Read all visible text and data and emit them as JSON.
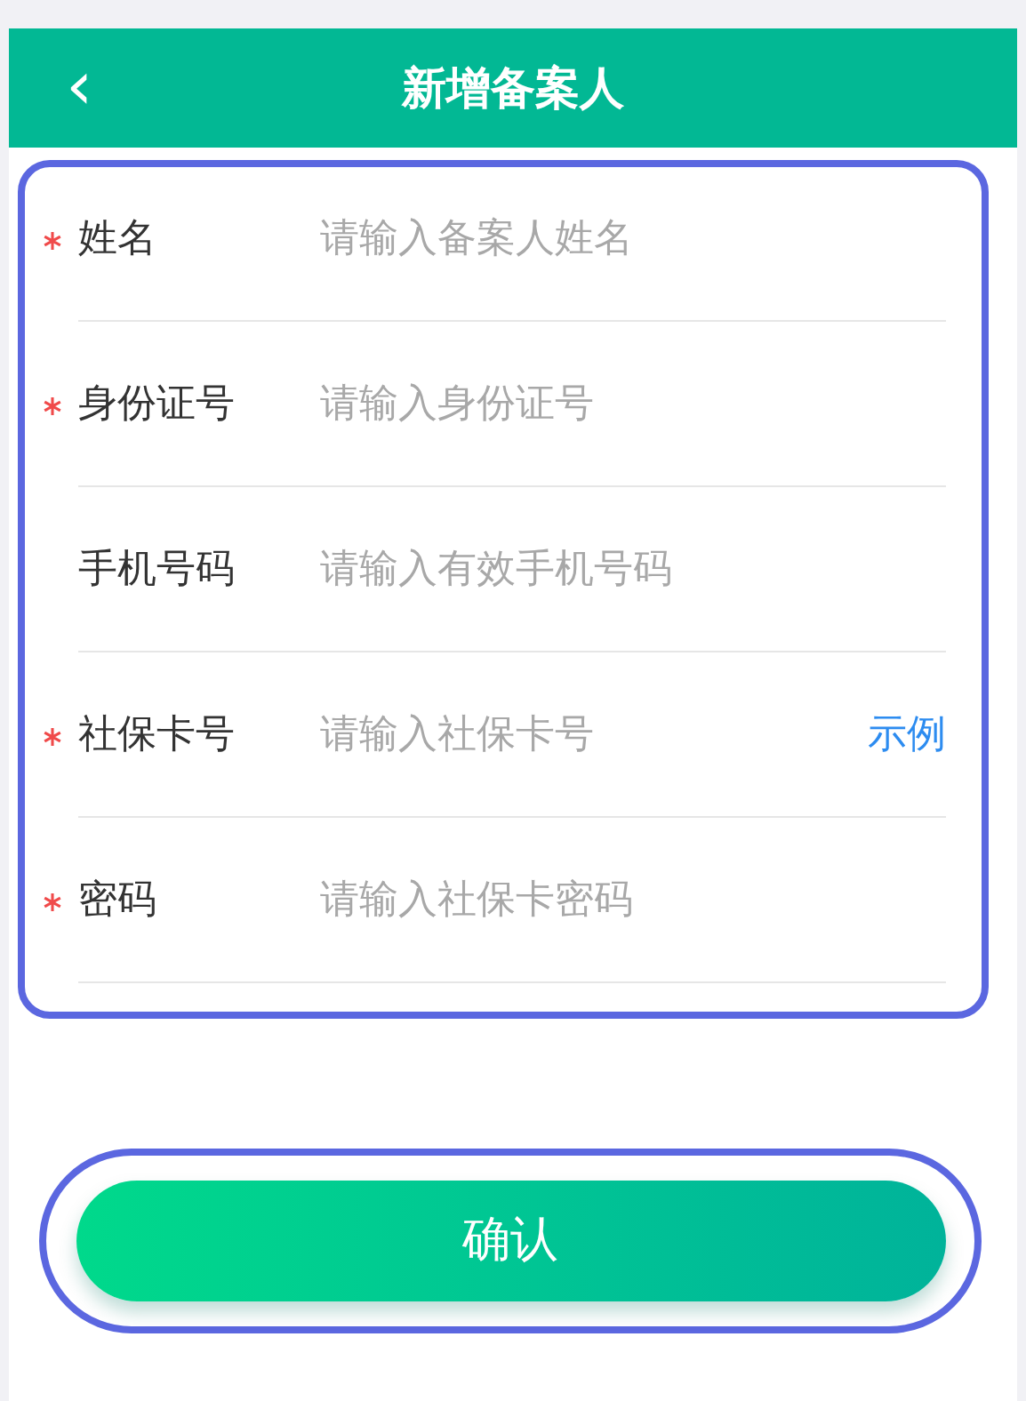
{
  "header": {
    "back_icon": "‹",
    "title": "新增备案人"
  },
  "fields": [
    {
      "label": "姓名",
      "placeholder": "请输入备案人姓名",
      "required": true
    },
    {
      "label": "身份证号",
      "placeholder": "请输入身份证号",
      "required": true
    },
    {
      "label": "手机号码",
      "placeholder": "请输入有效手机号码",
      "required": false
    },
    {
      "label": "社保卡号",
      "placeholder": "请输入社保卡号",
      "required": true,
      "link": "示例"
    },
    {
      "label": "密码",
      "placeholder": "请输入社保卡密码",
      "required": true
    }
  ],
  "confirm_button": "确认"
}
